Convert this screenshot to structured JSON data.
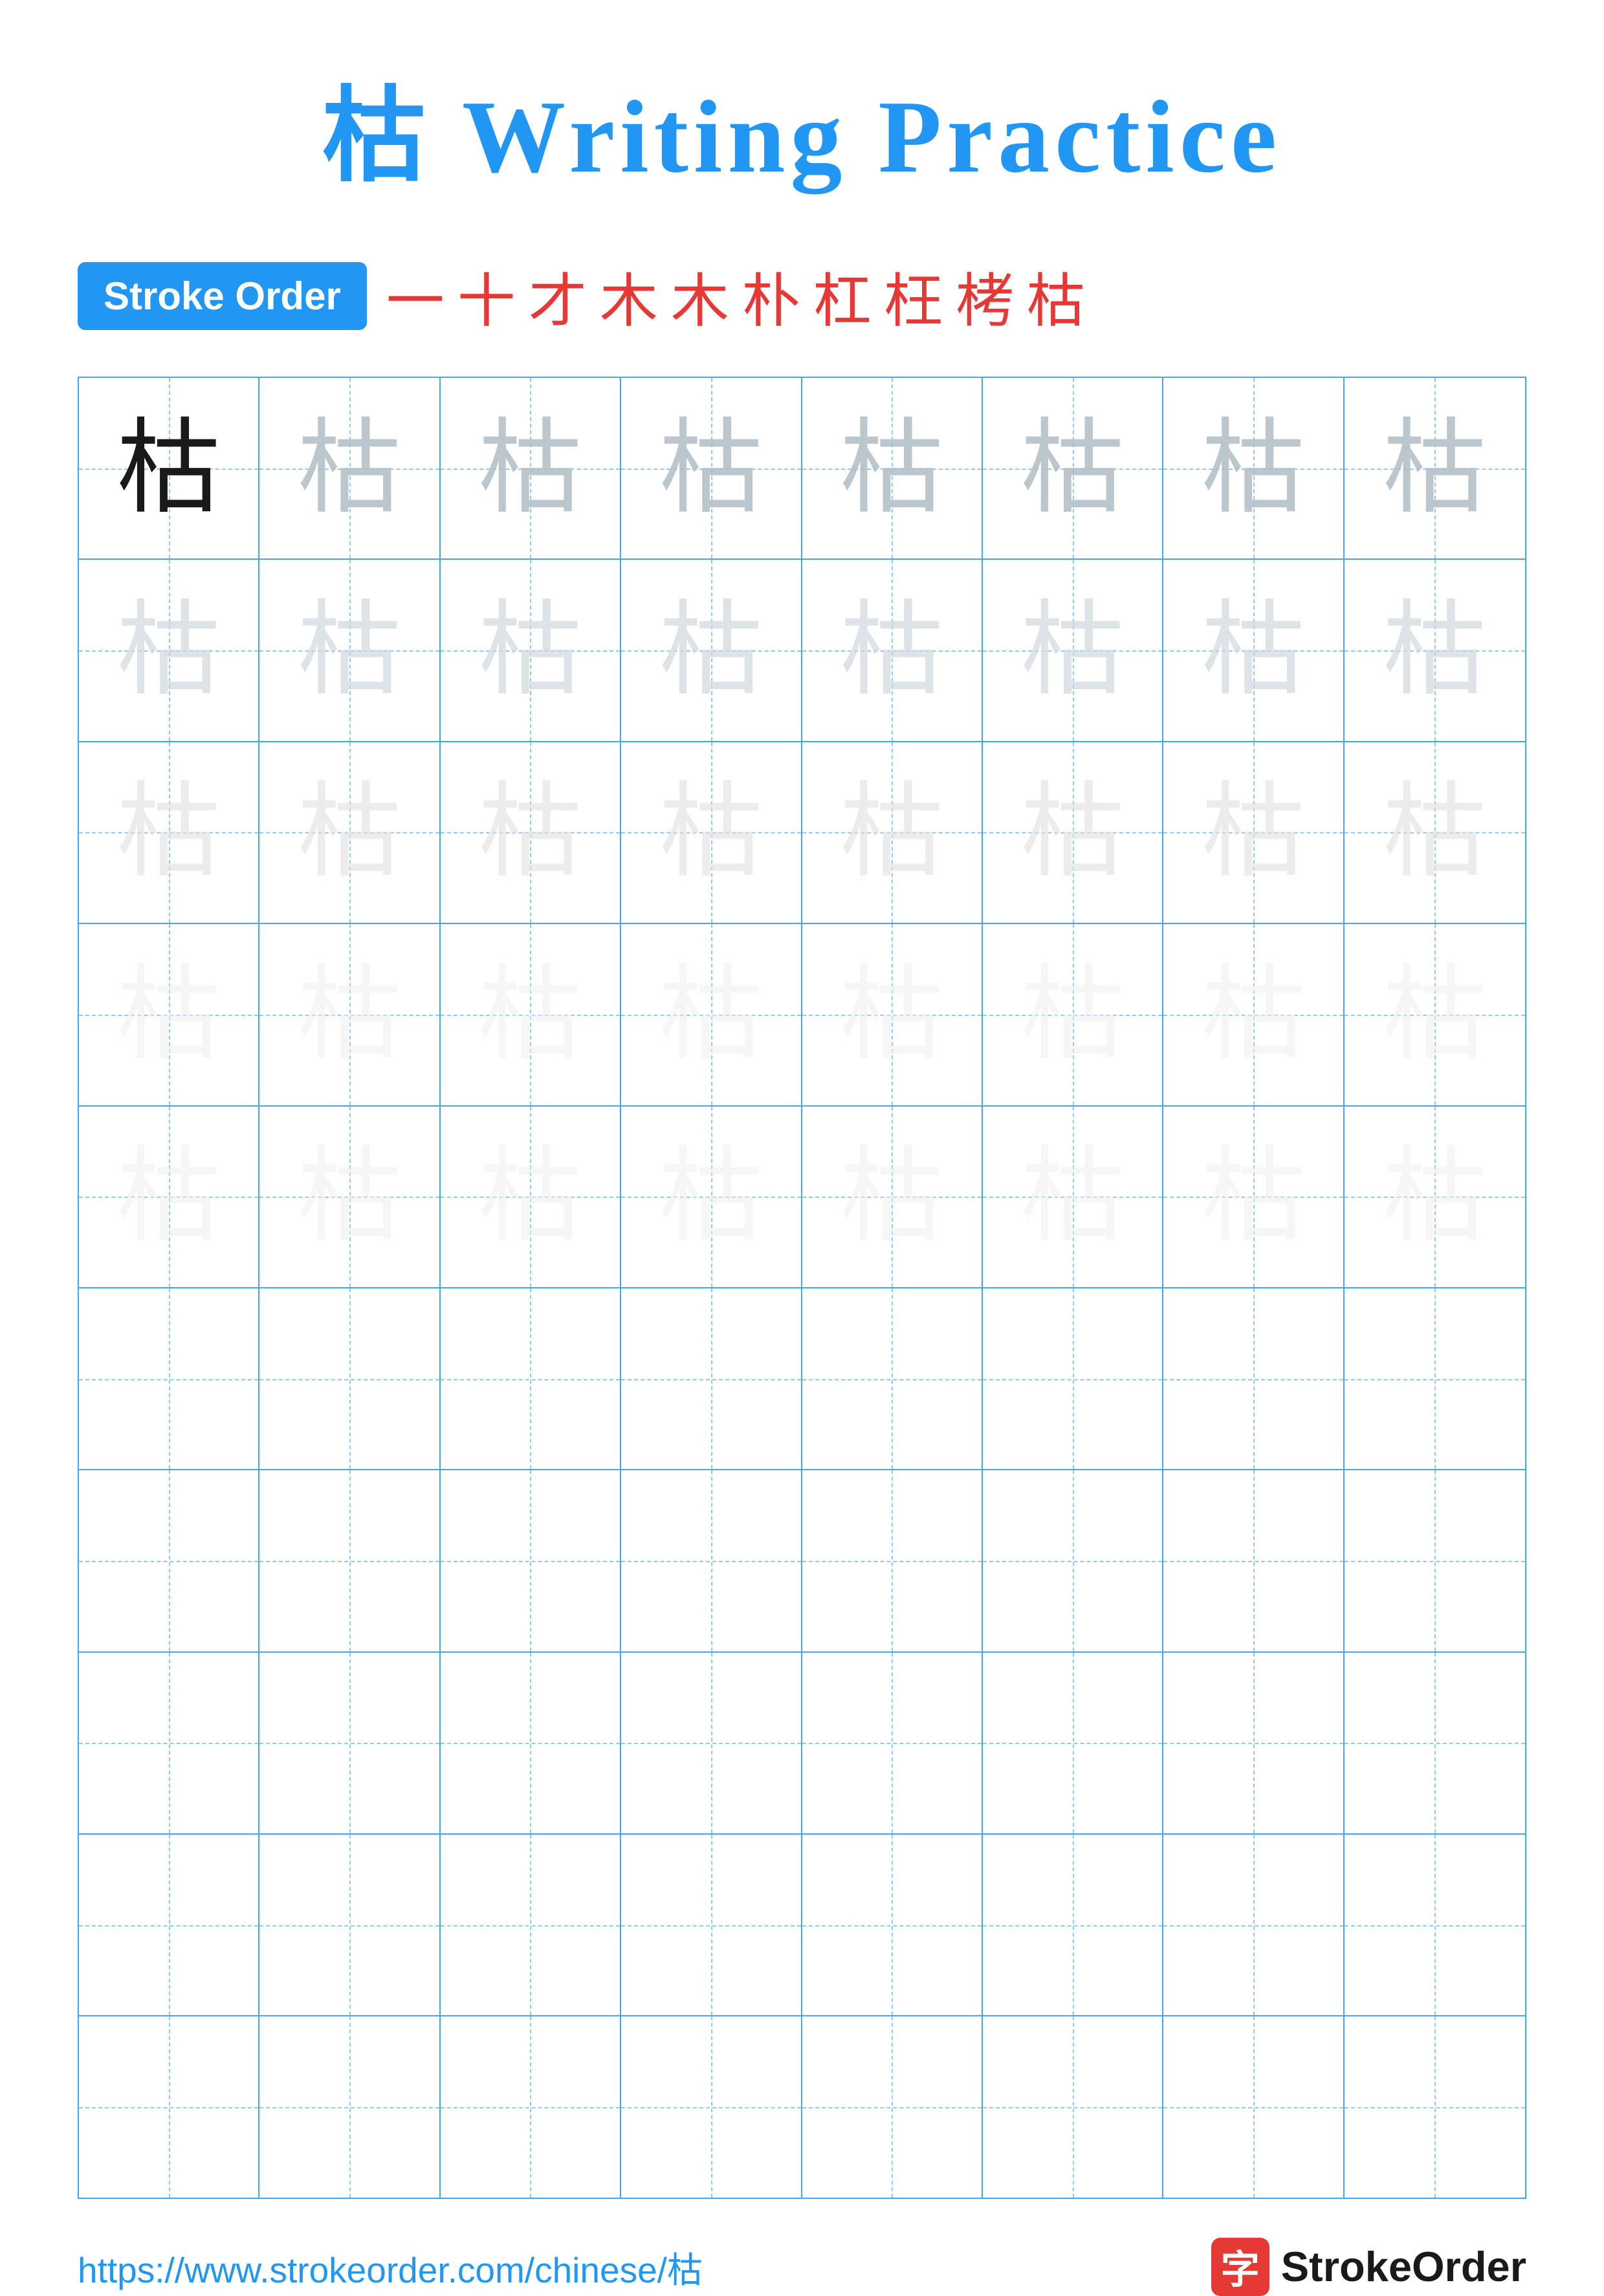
{
  "title": "枯 Writing Practice",
  "stroke_order_badge": "Stroke Order",
  "stroke_sequence": [
    "一",
    "十",
    "才",
    "木",
    "木",
    "朴",
    "杠",
    "枉",
    "栲",
    "枯"
  ],
  "character": "枯",
  "url": "https://www.strokeorder.com/chinese/枯",
  "brand_name": "StrokeOrder",
  "brand_char": "字",
  "grid": {
    "rows": 10,
    "cols": 8,
    "practice_rows": [
      [
        "dark",
        "light1",
        "light1",
        "light1",
        "light1",
        "light1",
        "light1",
        "light1"
      ],
      [
        "light2",
        "light2",
        "light2",
        "light2",
        "light2",
        "light2",
        "light2",
        "light2"
      ],
      [
        "light3",
        "light3",
        "light3",
        "light3",
        "light3",
        "light3",
        "light3",
        "light3"
      ],
      [
        "light4",
        "light4",
        "light4",
        "light4",
        "light4",
        "light4",
        "light4",
        "light4"
      ],
      [
        "light4",
        "light4",
        "light4",
        "light4",
        "light4",
        "light4",
        "light4",
        "light4"
      ],
      [
        "empty",
        "empty",
        "empty",
        "empty",
        "empty",
        "empty",
        "empty",
        "empty"
      ],
      [
        "empty",
        "empty",
        "empty",
        "empty",
        "empty",
        "empty",
        "empty",
        "empty"
      ],
      [
        "empty",
        "empty",
        "empty",
        "empty",
        "empty",
        "empty",
        "empty",
        "empty"
      ],
      [
        "empty",
        "empty",
        "empty",
        "empty",
        "empty",
        "empty",
        "empty",
        "empty"
      ],
      [
        "empty",
        "empty",
        "empty",
        "empty",
        "empty",
        "empty",
        "empty",
        "empty"
      ]
    ]
  }
}
